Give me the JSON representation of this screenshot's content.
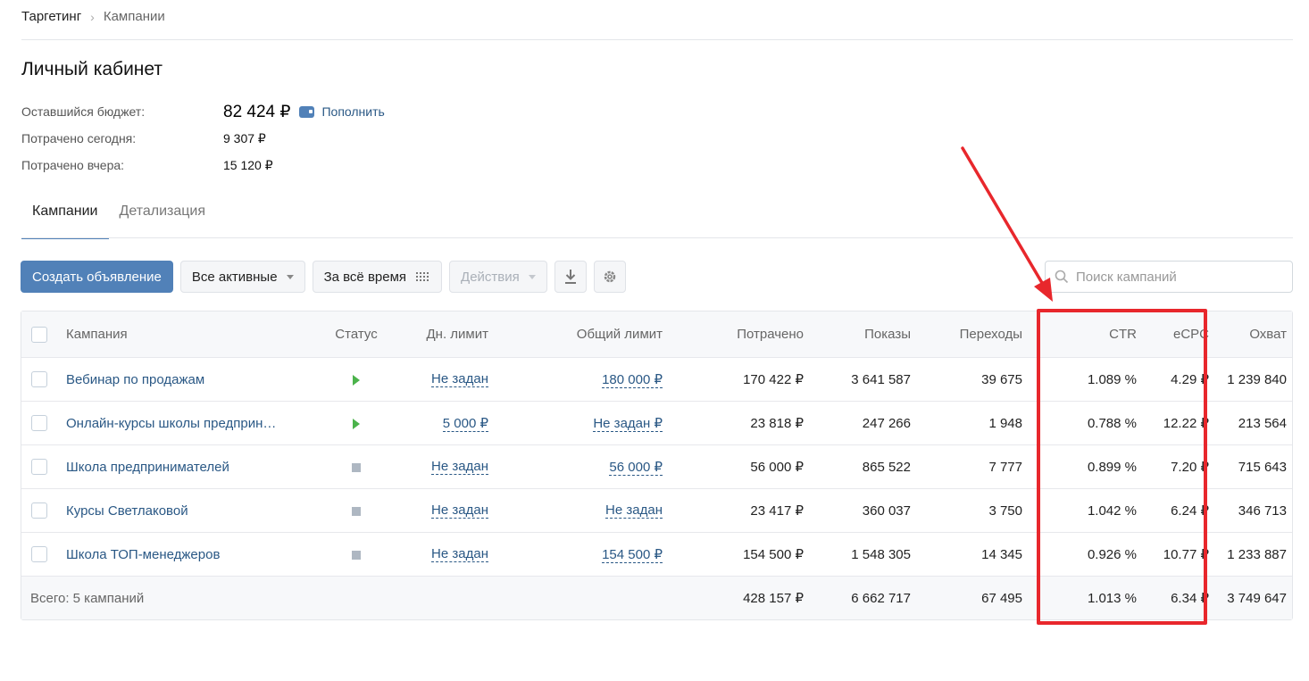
{
  "breadcrumb": {
    "root": "Таргетинг",
    "current": "Кампании"
  },
  "page_title": "Личный кабинет",
  "budget": {
    "remaining_label": "Оставшийся бюджет:",
    "remaining_value": "82 424 ₽",
    "topup_label": "Пополнить",
    "spent_today_label": "Потрачено сегодня:",
    "spent_today_value": "9 307 ₽",
    "spent_yesterday_label": "Потрачено вчера:",
    "spent_yesterday_value": "15 120 ₽"
  },
  "tabs": [
    {
      "label": "Кампании",
      "active": true
    },
    {
      "label": "Детализация",
      "active": false
    }
  ],
  "toolbar": {
    "create_label": "Создать объявление",
    "filter_label": "Все активные",
    "period_label": "За всё время",
    "actions_label": "Действия"
  },
  "search": {
    "placeholder": "Поиск кампаний"
  },
  "table": {
    "headers": {
      "campaign": "Кампания",
      "status": "Статус",
      "day_limit": "Дн. лимит",
      "total_limit": "Общий лимит",
      "spent": "Потрачено",
      "shows": "Показы",
      "clicks": "Переходы",
      "ctr": "CTR",
      "ecpc": "eCPC",
      "reach": "Охват"
    },
    "rows": [
      {
        "name": "Вебинар по продажам",
        "status": "play",
        "day_limit": "Не задан",
        "total_limit": "180 000 ₽",
        "spent": "170 422 ₽",
        "shows": "3 641 587",
        "clicks": "39 675",
        "ctr": "1.089 %",
        "ecpc": "4.29 ₽",
        "reach": "1 239 840"
      },
      {
        "name": "Онлайн-курсы школы предприн…",
        "status": "play",
        "day_limit": "5 000 ₽",
        "total_limit": "Не задан ₽",
        "spent": "23 818 ₽",
        "shows": "247 266",
        "clicks": "1 948",
        "ctr": "0.788 %",
        "ecpc": "12.22 ₽",
        "reach": "213 564"
      },
      {
        "name": "Школа предпринимателей",
        "status": "stop",
        "day_limit": "Не задан",
        "total_limit": "56 000 ₽",
        "spent": "56 000 ₽",
        "shows": "865 522",
        "clicks": "7 777",
        "ctr": "0.899 %",
        "ecpc": "7.20 ₽",
        "reach": "715 643"
      },
      {
        "name": "Курсы Светлаковой",
        "status": "stop",
        "day_limit": "Не задан",
        "total_limit": "Не задан",
        "spent": "23 417 ₽",
        "shows": "360 037",
        "clicks": "3 750",
        "ctr": "1.042 %",
        "ecpc": "6.24 ₽",
        "reach": "346 713"
      },
      {
        "name": "Школа ТОП-менеджеров",
        "status": "stop",
        "day_limit": "Не задан",
        "total_limit": "154 500 ₽",
        "spent": "154 500 ₽",
        "shows": "1 548 305",
        "clicks": "14 345",
        "ctr": "0.926 %",
        "ecpc": "10.77 ₽",
        "reach": "1 233 887"
      }
    ],
    "total": {
      "label": "Всего: 5 кампаний",
      "spent": "428 157 ₽",
      "shows": "6 662 717",
      "clicks": "67 495",
      "ctr": "1.013 %",
      "ecpc": "6.34 ₽",
      "reach": "3 749 647"
    }
  },
  "annotation": {
    "color": "#e8272c"
  }
}
